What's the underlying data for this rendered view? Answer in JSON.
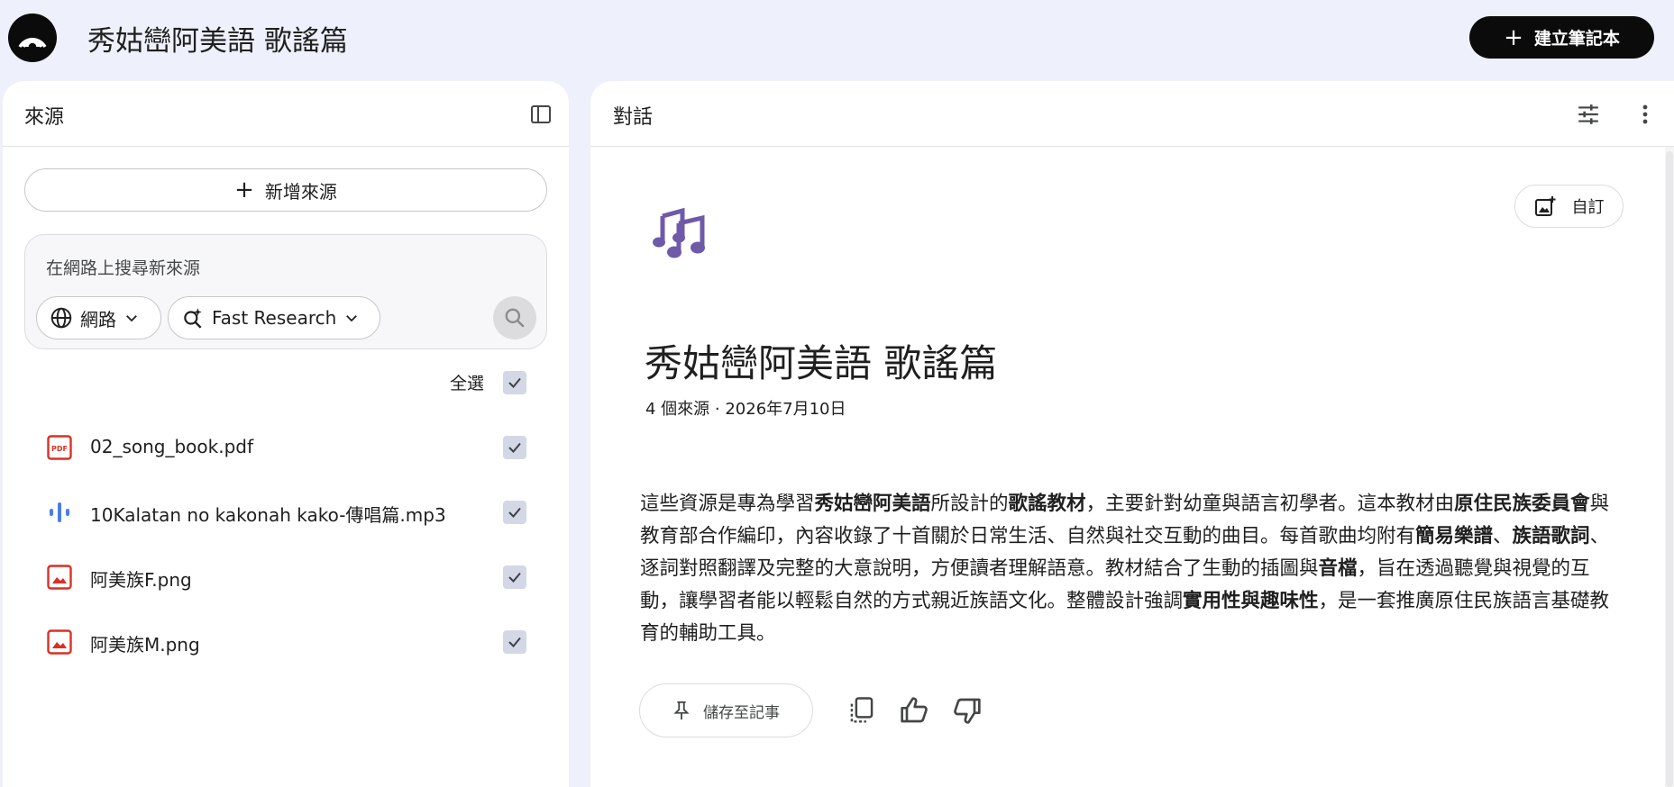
{
  "header": {
    "title": "秀姑巒阿美語 歌謠篇",
    "create_label": "建立筆記本",
    "create_icon": "plus-icon",
    "logo_icon": "notebooklm-logo"
  },
  "sources_panel": {
    "title": "來源",
    "toggle_icon": "panel-toggle-icon",
    "add_source_label": "新增來源",
    "search": {
      "placeholder": "在網路上搜尋新來源",
      "source_type": "網路",
      "mode": "Fast Research",
      "submit_icon": "search-icon"
    },
    "select_all_label": "全選",
    "select_all_checked": true,
    "items": [
      {
        "name": "02_song_book.pdf",
        "icon": "pdf-icon",
        "checked": true
      },
      {
        "name": "10Kalatan no kakonah kako-傳唱篇.mp3",
        "icon": "audio-icon",
        "checked": true
      },
      {
        "name": "阿美族F.png",
        "icon": "image-icon",
        "checked": true
      },
      {
        "name": "阿美族M.png",
        "icon": "image-icon",
        "checked": true
      }
    ]
  },
  "chat_panel": {
    "title": "對話",
    "settings_icon": "tune-icon",
    "menu_icon": "more-vert-icon",
    "customize_label": "自訂",
    "notebook_icon": "music-notes-icon",
    "notebook_title": "秀姑巒阿美語 歌謠篇",
    "meta": "4 個來源 · 2026年7月10日",
    "save_note_label": "儲存至記事",
    "colors": {
      "icon_purple": "#6e5aa8",
      "pdf_red": "#d93025",
      "audio_blue": "#4a7ee8"
    }
  }
}
